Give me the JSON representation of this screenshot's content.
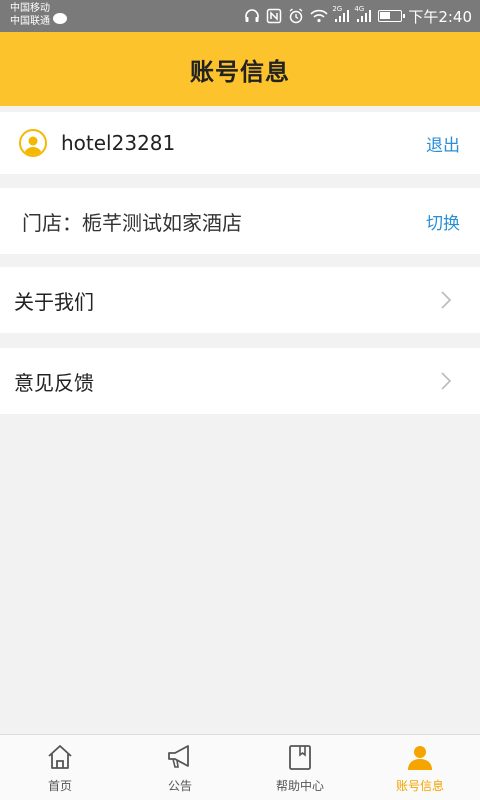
{
  "status_bar": {
    "carrier1": "中国移动",
    "carrier2": "中国联通",
    "net1": "2G",
    "net2": "4G",
    "time": "下午2:40"
  },
  "header": {
    "title": "账号信息"
  },
  "user": {
    "username": "hotel23281",
    "logout_label": "退出"
  },
  "store": {
    "label": "门店：",
    "name": "栀芊测试如家酒店",
    "switch_label": "切换"
  },
  "menu": [
    {
      "label": "关于我们"
    },
    {
      "label": "意见反馈"
    }
  ],
  "nav": {
    "items": [
      {
        "label": "首页",
        "icon": "home-icon"
      },
      {
        "label": "公告",
        "icon": "megaphone-icon"
      },
      {
        "label": "帮助中心",
        "icon": "book-icon"
      },
      {
        "label": "账号信息",
        "icon": "user-icon"
      }
    ],
    "active_index": 3,
    "active_color": "#f5a400",
    "inactive_color": "#555555"
  },
  "colors": {
    "header": "#fdc32c",
    "link": "#2a8fd7"
  }
}
